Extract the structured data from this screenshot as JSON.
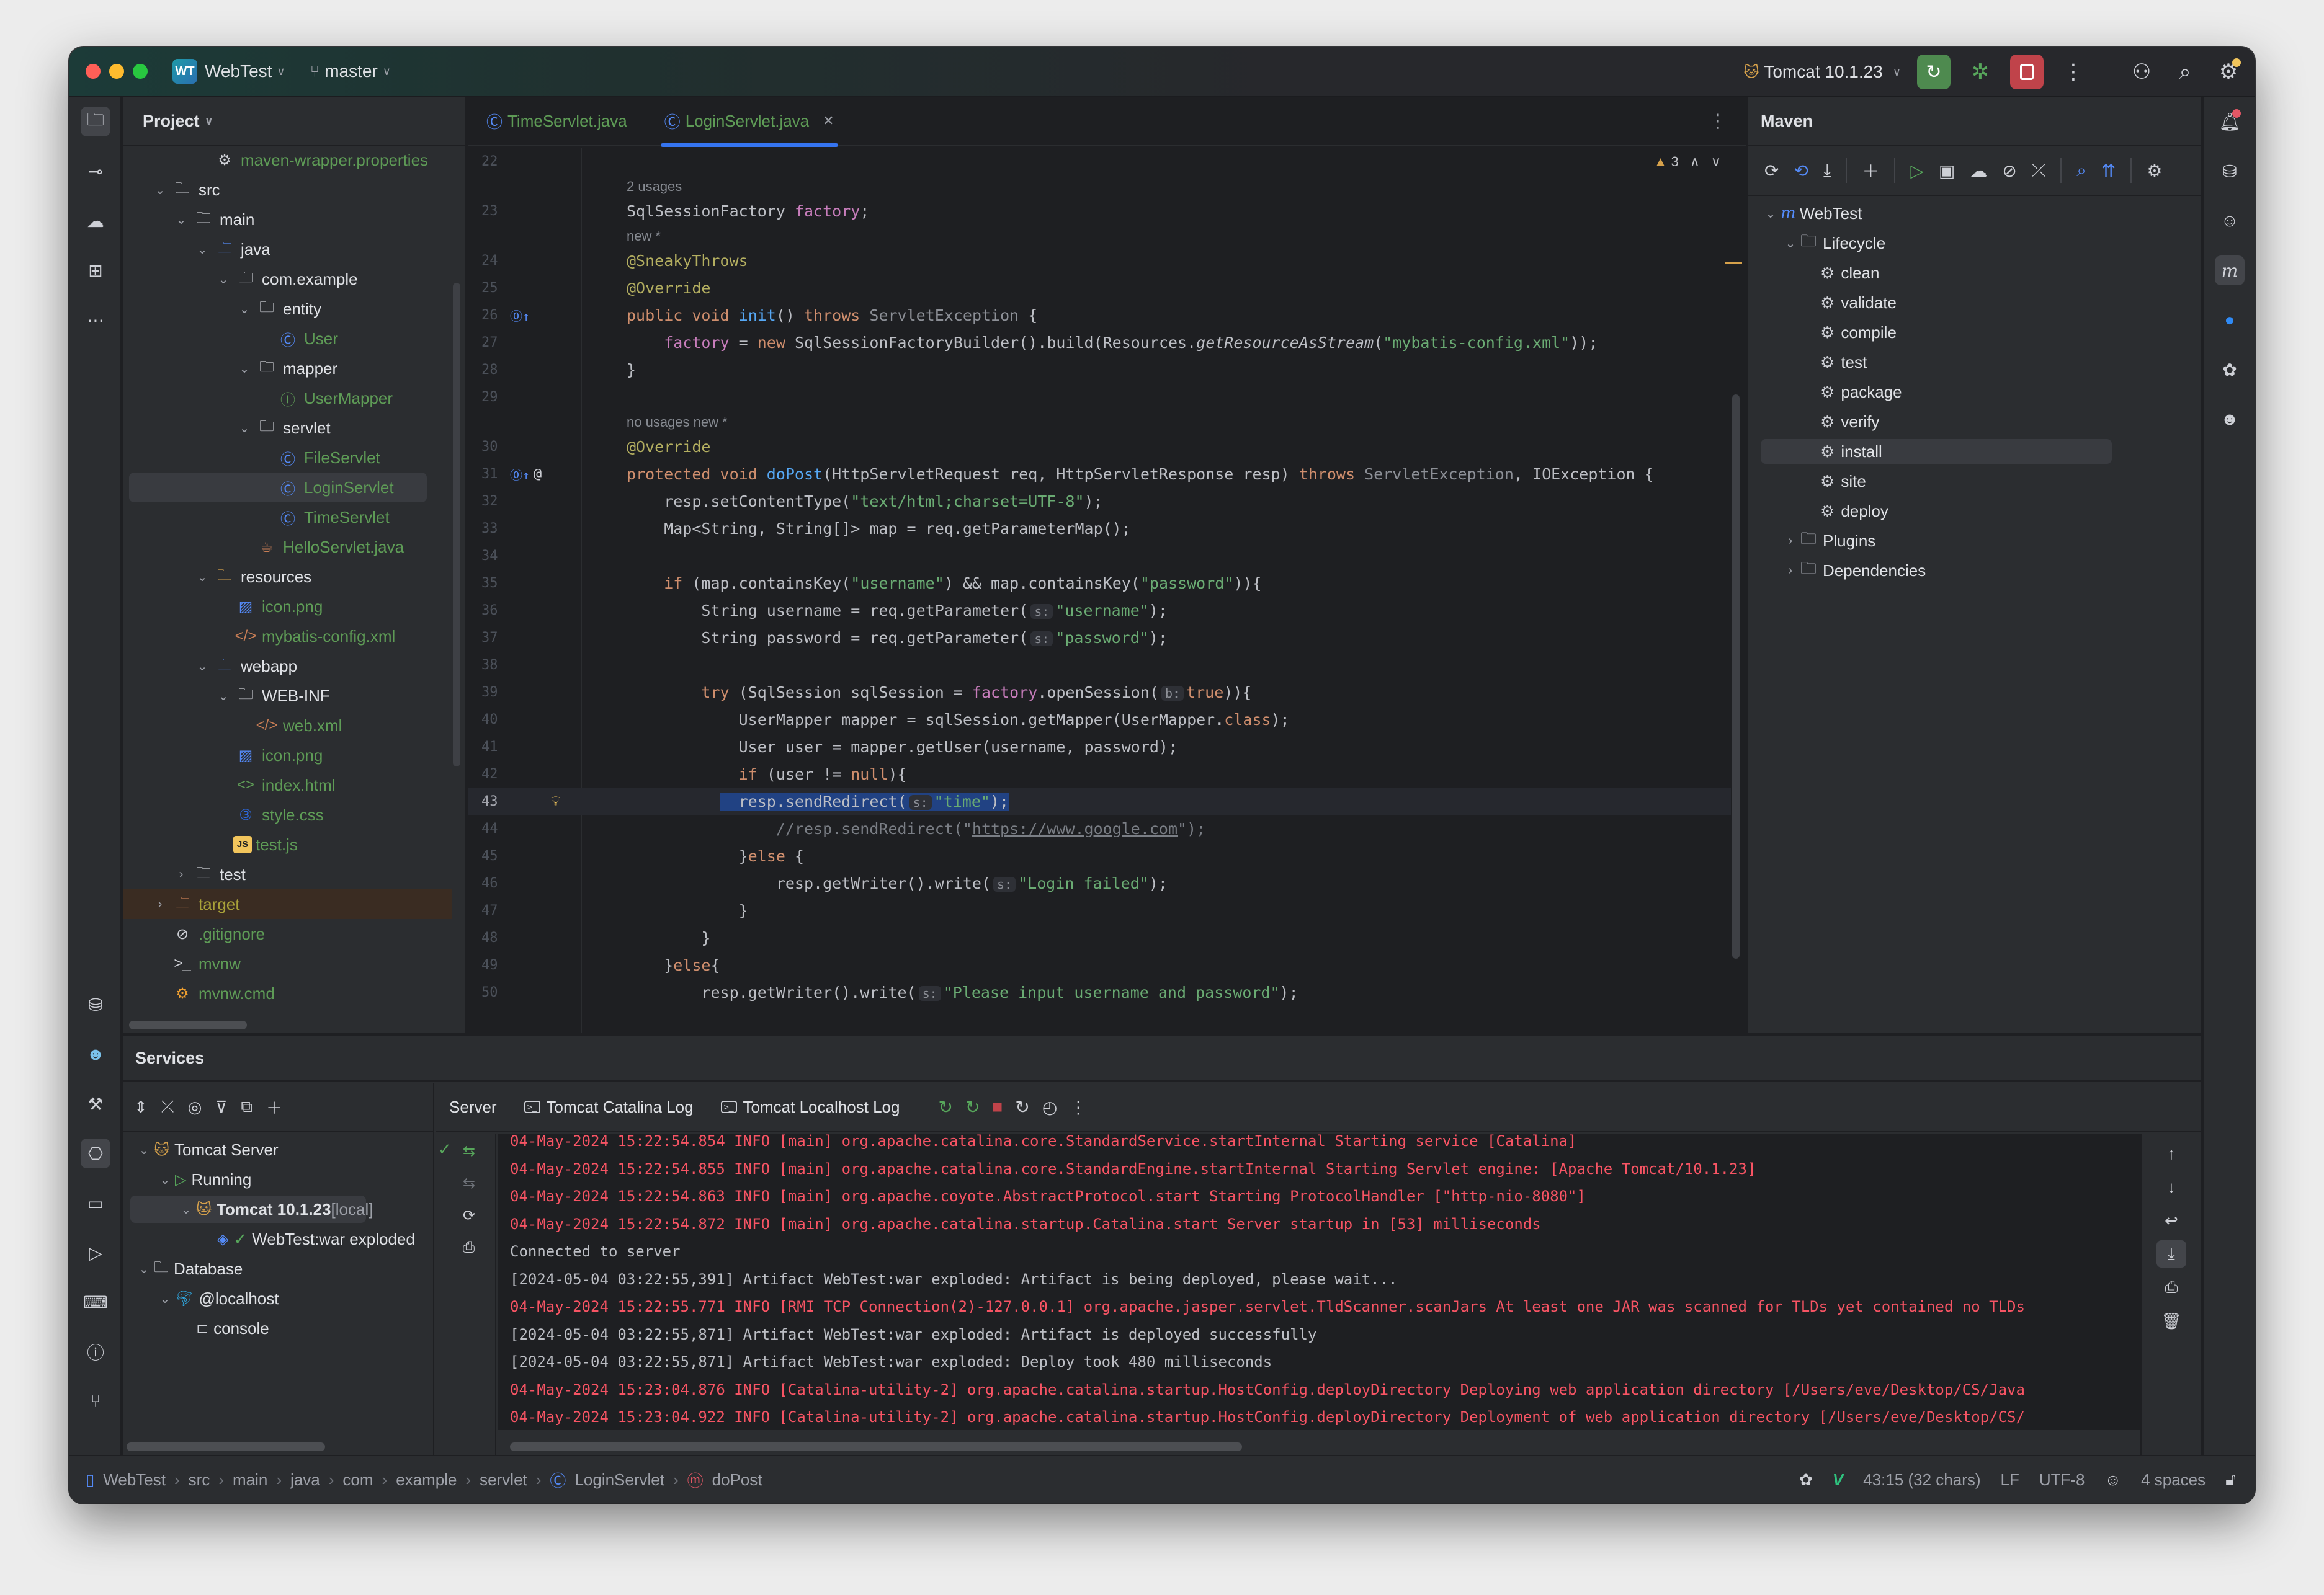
{
  "titlebar": {
    "project_badge": "WT",
    "project_name": "WebTest",
    "branch": "master",
    "run_config": "Tomcat 10.1.23",
    "colors": {
      "rerun": "#4e8a4f",
      "stop": "#c0434a",
      "debug": "#57a65b"
    }
  },
  "project_panel": {
    "title": "Project",
    "tree": [
      {
        "label": "maven-wrapper.properties",
        "icon": "gear-icon",
        "depth": 2,
        "arrow": "",
        "color": "green"
      },
      {
        "label": "src",
        "icon": "folder-icon",
        "depth": 0,
        "arrow": "down",
        "color": "white"
      },
      {
        "label": "main",
        "icon": "folder-icon",
        "depth": 1,
        "arrow": "down",
        "color": "white"
      },
      {
        "label": "java",
        "icon": "source-folder-icon",
        "depth": 2,
        "arrow": "down",
        "color": "white"
      },
      {
        "label": "com.example",
        "icon": "package-icon",
        "depth": 3,
        "arrow": "down",
        "color": "white"
      },
      {
        "label": "entity",
        "icon": "package-icon",
        "depth": 4,
        "arrow": "down",
        "color": "white"
      },
      {
        "label": "User",
        "icon": "class-icon",
        "depth": 5,
        "arrow": "",
        "color": "green"
      },
      {
        "label": "mapper",
        "icon": "package-icon",
        "depth": 4,
        "arrow": "down",
        "color": "white"
      },
      {
        "label": "UserMapper",
        "icon": "interface-icon",
        "depth": 5,
        "arrow": "",
        "color": "green"
      },
      {
        "label": "servlet",
        "icon": "package-icon",
        "depth": 4,
        "arrow": "down",
        "color": "white"
      },
      {
        "label": "FileServlet",
        "icon": "class-icon",
        "depth": 5,
        "arrow": "",
        "color": "green"
      },
      {
        "label": "LoginServlet",
        "icon": "class-icon",
        "depth": 5,
        "arrow": "",
        "color": "green",
        "selected": true
      },
      {
        "label": "TimeServlet",
        "icon": "class-icon",
        "depth": 5,
        "arrow": "",
        "color": "green"
      },
      {
        "label": "HelloServlet.java",
        "icon": "java-file-icon",
        "depth": 4,
        "arrow": "",
        "color": "green"
      },
      {
        "label": "resources",
        "icon": "resources-folder-icon",
        "depth": 2,
        "arrow": "down",
        "color": "white"
      },
      {
        "label": "icon.png",
        "icon": "image-icon",
        "depth": 3,
        "arrow": "",
        "color": "green"
      },
      {
        "label": "mybatis-config.xml",
        "icon": "xml-icon",
        "depth": 3,
        "arrow": "",
        "color": "green"
      },
      {
        "label": "webapp",
        "icon": "web-folder-icon",
        "depth": 2,
        "arrow": "down",
        "color": "white"
      },
      {
        "label": "WEB-INF",
        "icon": "folder-icon",
        "depth": 3,
        "arrow": "down",
        "color": "white"
      },
      {
        "label": "web.xml",
        "icon": "web-xml-icon",
        "depth": 4,
        "arrow": "",
        "color": "green"
      },
      {
        "label": "icon.png",
        "icon": "image-icon",
        "depth": 3,
        "arrow": "",
        "color": "green"
      },
      {
        "label": "index.html",
        "icon": "html-icon",
        "depth": 3,
        "arrow": "",
        "color": "green"
      },
      {
        "label": "style.css",
        "icon": "css-icon",
        "depth": 3,
        "arrow": "",
        "color": "green"
      },
      {
        "label": "test.js",
        "icon": "js-icon",
        "depth": 3,
        "arrow": "",
        "color": "green"
      },
      {
        "label": "test",
        "icon": "folder-icon",
        "depth": 1,
        "arrow": "right",
        "color": "white"
      },
      {
        "label": "target",
        "icon": "excluded-folder-icon",
        "depth": 0,
        "arrow": "right",
        "color": "olive",
        "highlight": true
      },
      {
        "label": ".gitignore",
        "icon": "ignore-icon",
        "depth": 0,
        "arrow": "",
        "color": "green"
      },
      {
        "label": "mvnw",
        "icon": "terminal-file-icon",
        "depth": 0,
        "arrow": "",
        "color": "green"
      },
      {
        "label": "mvnw.cmd",
        "icon": "cmd-file-icon",
        "depth": 0,
        "arrow": "",
        "color": "green"
      }
    ]
  },
  "editor": {
    "tabs": [
      {
        "label": "TimeServlet.java",
        "active": false
      },
      {
        "label": "LoginServlet.java",
        "active": true
      }
    ],
    "warnings_count": "3",
    "cursor_line": "43",
    "lines": [
      {
        "n": "22",
        "html": ""
      },
      {
        "hint": "2 usages"
      },
      {
        "n": "23",
        "html": "SqlSessionFactory <span class='f'>factory</span>;"
      },
      {
        "hint": "new *"
      },
      {
        "n": "24",
        "html": "<span class='an'>@SneakyThrows</span>"
      },
      {
        "n": "25",
        "html": "<span class='an'>@Override</span>"
      },
      {
        "n": "26",
        "mark": "override",
        "html": "<span class='k'>public void</span> <span class='fn'>init</span>() <span class='k'>throws</span> <span class='ex'>ServletException</span> {"
      },
      {
        "n": "27",
        "html": "    <span class='f'>factory</span> = <span class='k'>new</span> SqlSessionFactoryBuilder().build(Resources.<span class='it'>getResourceAsStream</span>(<span class='s'>\"mybatis-config.xml\"</span>));"
      },
      {
        "n": "28",
        "html": "}"
      },
      {
        "n": "29",
        "html": ""
      },
      {
        "hint": "no usages   new *"
      },
      {
        "n": "30",
        "html": "<span class='an'>@Override</span>"
      },
      {
        "n": "31",
        "mark": "override-at",
        "html": "<span class='k'>protected void</span> <span class='fn'>doPost</span>(HttpServletRequest req, HttpServletResponse resp) <span class='k'>throws</span> <span class='ex'>ServletException</span>, IOException {"
      },
      {
        "n": "32",
        "html": "    resp.setContentType(<span class='s'>\"text/html;charset=UTF-8\"</span>);"
      },
      {
        "n": "33",
        "html": "    Map&lt;String, String[]&gt; map = req.getParameterMap();"
      },
      {
        "n": "34",
        "html": ""
      },
      {
        "n": "35",
        "html": "    <span class='k'>if</span> (map.containsKey(<span class='s'>\"username\"</span>) &amp;&amp; map.containsKey(<span class='s'>\"password\"</span>)){"
      },
      {
        "n": "36",
        "html": "        String username = req.getParameter(<span class='inlay'>s:</span><span class='s'>\"username\"</span>);"
      },
      {
        "n": "37",
        "html": "        String password = req.getParameter(<span class='inlay'>s:</span><span class='s'>\"password\"</span>);"
      },
      {
        "n": "38",
        "html": ""
      },
      {
        "n": "39",
        "html": "        <span class='k'>try</span> (SqlSession sqlSession = <span class='f'>factory</span>.openSession(<span class='inlay'>b:</span><span class='k'>true</span>)){"
      },
      {
        "n": "40",
        "html": "            UserMapper mapper = sqlSession.getMapper(UserMapper.<span class='k'>class</span>);"
      },
      {
        "n": "41",
        "html": "            User user = mapper.getUser(username, password);"
      },
      {
        "n": "42",
        "html": "            <span class='k'>if</span> (user != <span class='k'>null</span>){"
      },
      {
        "n": "43",
        "current": true,
        "bulb": true,
        "html": "          <span class='selbox'>  resp.sendRedirect(<span class='inlay'>s:</span><span class='s'>\"time\"</span>);</span>"
      },
      {
        "n": "44",
        "html": "                <span class='cm'>//resp.sendRedirect(\"<u>https://www.google.com</u>\");</span>"
      },
      {
        "n": "45",
        "html": "            }<span class='k'>else</span> {"
      },
      {
        "n": "46",
        "html": "                resp.getWriter().write(<span class='inlay'>s:</span><span class='s'>\"Login failed\"</span>);"
      },
      {
        "n": "47",
        "html": "            }"
      },
      {
        "n": "48",
        "html": "        }"
      },
      {
        "n": "49",
        "html": "    }<span class='k'>else</span>{"
      },
      {
        "n": "50",
        "html": "        resp.getWriter().write(<span class='inlay'>s:</span><span class='s'>\"Please input username and password\"</span>);"
      }
    ]
  },
  "maven": {
    "title": "Maven",
    "project": "WebTest",
    "lifecycle_label": "Lifecycle",
    "goals": [
      "clean",
      "validate",
      "compile",
      "test",
      "package",
      "verify",
      "install",
      "site",
      "deploy"
    ],
    "selected_goal": "install",
    "plugins_label": "Plugins",
    "dependencies_label": "Dependencies"
  },
  "services": {
    "title": "Services",
    "tree": [
      {
        "label": "Tomcat Server",
        "icon": "tomcat-icon",
        "depth": 0,
        "arrow": "down"
      },
      {
        "label": "Running",
        "icon": "run-icon",
        "depth": 1,
        "arrow": "down"
      },
      {
        "label": "Tomcat 10.1.23",
        "suffix": "[local]",
        "icon": "tomcat-running-icon",
        "depth": 2,
        "arrow": "down",
        "selected": true,
        "bold": true
      },
      {
        "label": "WebTest:war exploded",
        "icon": "artifact-icon",
        "depth": 3,
        "arrow": ""
      },
      {
        "label": "Database",
        "icon": "folder-icon",
        "depth": 0,
        "arrow": "down"
      },
      {
        "label": "@localhost",
        "icon": "mysql-icon",
        "depth": 1,
        "arrow": "down"
      },
      {
        "label": "console",
        "icon": "console-icon",
        "depth": 2,
        "arrow": ""
      }
    ],
    "tabs": [
      "Server",
      "Tomcat Catalina Log",
      "Tomcat Localhost Log"
    ],
    "log": [
      {
        "type": "err",
        "text": "04-May-2024 15:22:54.854 INFO [main] org.apache.catalina.core.StandardService.startInternal Starting service [Catalina]"
      },
      {
        "type": "err",
        "text": "04-May-2024 15:22:54.855 INFO [main] org.apache.catalina.core.StandardEngine.startInternal Starting Servlet engine: [Apache Tomcat/10.1.23]"
      },
      {
        "type": "err",
        "text": "04-May-2024 15:22:54.863 INFO [main] org.apache.coyote.AbstractProtocol.start Starting ProtocolHandler [\"http-nio-8080\"]"
      },
      {
        "type": "err",
        "text": "04-May-2024 15:22:54.872 INFO [main] org.apache.catalina.startup.Catalina.start Server startup in [53] milliseconds"
      },
      {
        "type": "norm",
        "text": "Connected to server"
      },
      {
        "type": "norm",
        "text": "[2024-05-04 03:22:55,391] Artifact WebTest:war exploded: Artifact is being deployed, please wait..."
      },
      {
        "type": "err",
        "text": "04-May-2024 15:22:55.771 INFO [RMI TCP Connection(2)-127.0.0.1] org.apache.jasper.servlet.TldScanner.scanJars At least one JAR was scanned for TLDs yet contained no TLDs"
      },
      {
        "type": "norm",
        "text": "[2024-05-04 03:22:55,871] Artifact WebTest:war exploded: Artifact is deployed successfully"
      },
      {
        "type": "norm",
        "text": "[2024-05-04 03:22:55,871] Artifact WebTest:war exploded: Deploy took 480 milliseconds"
      },
      {
        "type": "err",
        "text": "04-May-2024 15:23:04.876 INFO [Catalina-utility-2] org.apache.catalina.startup.HostConfig.deployDirectory Deploying web application directory [/Users/eve/Desktop/CS/Java"
      },
      {
        "type": "err",
        "text": "04-May-2024 15:23:04.922 INFO [Catalina-utility-2] org.apache.catalina.startup.HostConfig.deployDirectory Deployment of web application directory [/Users/eve/Desktop/CS/"
      }
    ]
  },
  "statusbar": {
    "breadcrumbs": [
      "WebTest",
      "src",
      "main",
      "java",
      "com",
      "example",
      "servlet",
      "LoginServlet",
      "doPost"
    ],
    "position": "43:15 (32 chars)",
    "line_ending": "LF",
    "encoding": "UTF-8",
    "indent": "4 spaces"
  }
}
